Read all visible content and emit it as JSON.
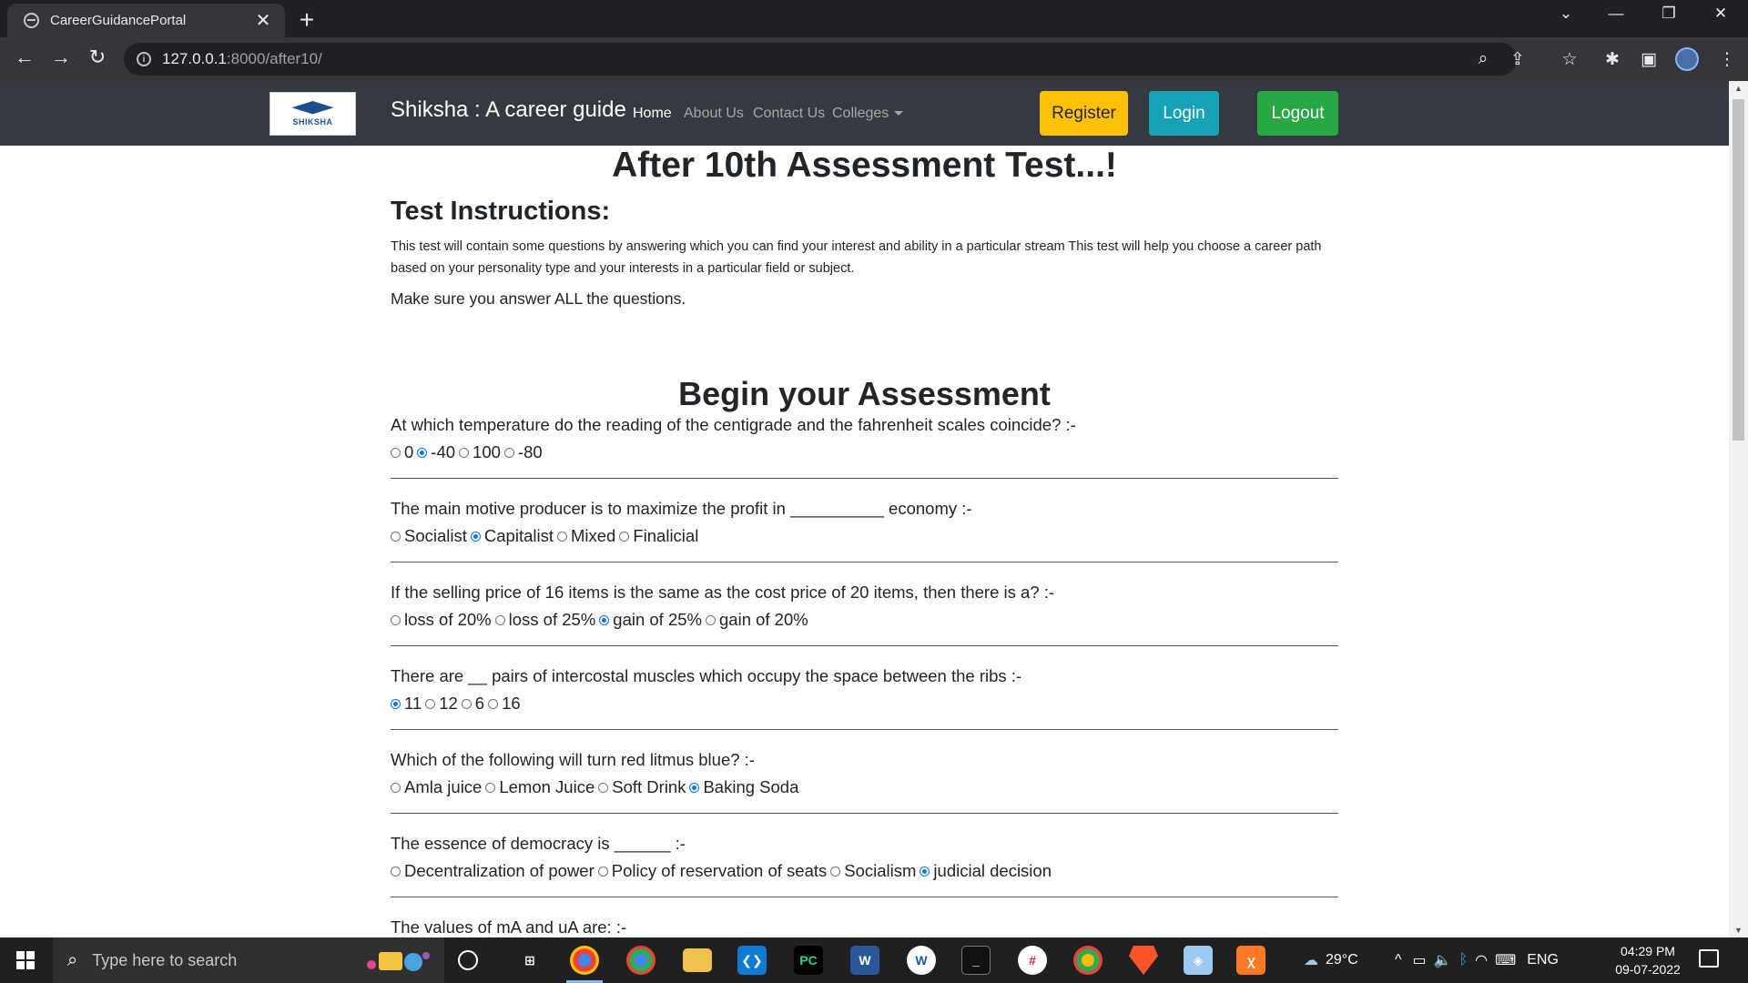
{
  "browser": {
    "tab_title": "CareerGuidancePortal",
    "url_host": "127.0.0.1",
    "url_path": ":8000/after10/"
  },
  "site": {
    "logo_text": "SHIKSHA",
    "brand": "Shiksha : A career guide",
    "nav": [
      "Home",
      "About Us",
      "Contact Us",
      "Colleges"
    ],
    "buttons": {
      "register": "Register",
      "login": "Login",
      "logout": "Logout"
    }
  },
  "page": {
    "title": "After 10th Assessment Test...!",
    "instructions_heading": "Test Instructions:",
    "instructions_text": "This test will contain some questions by answering which you can find your interest and ability in a particular stream This test will help you choose a career path based on your personality type and your interests in a particular field or subject.",
    "instructions_note": "Make sure you answer ALL the questions.",
    "assessment_heading": "Begin your Assessment"
  },
  "questions": [
    {
      "text": "At which temperature do the reading of the centigrade and the fahrenheit scales coincide? :-",
      "options": [
        "0",
        "-40",
        "100",
        "-80"
      ],
      "selected": 1
    },
    {
      "text": "The main motive producer is to maximize the profit in __________ economy :-",
      "options": [
        "Socialist",
        "Capitalist",
        "Mixed",
        "Finalicial"
      ],
      "selected": 1
    },
    {
      "text": "If the selling price of 16 items is the same as the cost price of 20 items, then there is a? :-",
      "options": [
        "loss of 20%",
        "loss of 25%",
        "gain of 25%",
        "gain of 20%"
      ],
      "selected": 2
    },
    {
      "text": "There are __ pairs of intercostal muscles which occupy the space between the ribs :-",
      "options": [
        "11",
        "12",
        "6",
        "16"
      ],
      "selected": 0
    },
    {
      "text": "Which of the following will turn red litmus blue? :-",
      "options": [
        "Amla juice",
        "Lemon Juice",
        "Soft Drink",
        "Baking Soda"
      ],
      "selected": 3
    },
    {
      "text": "The essence of democracy is ______ :-",
      "options": [
        "Decentralization of power",
        "Policy of reservation of seats",
        "Socialism",
        "judicial decision"
      ],
      "selected": 3
    },
    {
      "text": "The values of mA and uA are: :-",
      "options": [],
      "selected": -1
    }
  ],
  "taskbar": {
    "search_placeholder": "Type here to search",
    "weather": "29°C",
    "language": "ENG",
    "time": "04:29 PM",
    "date": "09-07-2022"
  }
}
